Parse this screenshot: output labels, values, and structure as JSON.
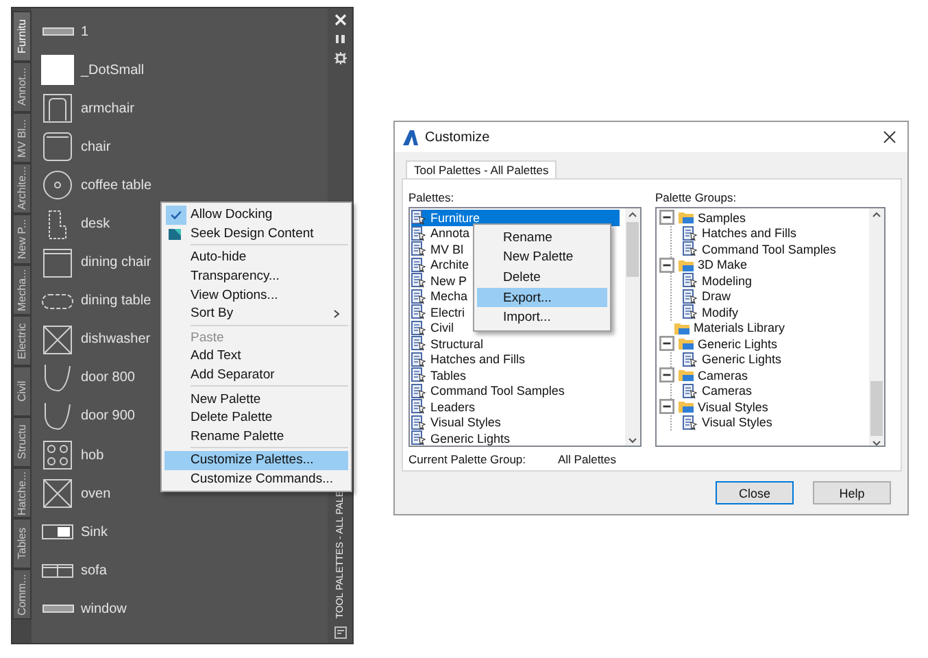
{
  "tool_palette": {
    "tabs": [
      {
        "label": "Furnitu",
        "selected": true
      },
      {
        "label": "Annot...",
        "selected": false
      },
      {
        "label": "MV Bl...",
        "selected": false
      },
      {
        "label": "Archite...",
        "selected": false
      },
      {
        "label": "New P...",
        "selected": false
      },
      {
        "label": "Mecha...",
        "selected": false
      },
      {
        "label": "Electric",
        "selected": false
      },
      {
        "label": "Civil",
        "selected": false
      },
      {
        "label": "Structu",
        "selected": false
      },
      {
        "label": "Hatche...",
        "selected": false
      },
      {
        "label": "Tables",
        "selected": false
      },
      {
        "label": "Comm...",
        "selected": false
      }
    ],
    "tools": [
      {
        "kind": "bar",
        "label": "1"
      },
      {
        "kind": "swatch",
        "label": "_DotSmall"
      },
      {
        "kind": "armchair",
        "label": "armchair"
      },
      {
        "kind": "chair",
        "label": "chair"
      },
      {
        "kind": "round",
        "label": "coffee table"
      },
      {
        "kind": "desk",
        "label": "desk"
      },
      {
        "kind": "square",
        "label": "dining chair"
      },
      {
        "kind": "oval",
        "label": "dining table"
      },
      {
        "kind": "crossed",
        "label": "dishwasher"
      },
      {
        "kind": "door",
        "label": "door 800"
      },
      {
        "kind": "door",
        "label": "door 900"
      },
      {
        "kind": "hob",
        "label": "hob"
      },
      {
        "kind": "crossed",
        "label": "oven"
      },
      {
        "kind": "sink",
        "label": "Sink"
      },
      {
        "kind": "sofa",
        "label": "sofa"
      },
      {
        "kind": "bar",
        "label": "window"
      }
    ],
    "title": "TOOL PALETTES - ALL PALE",
    "context_menu": [
      {
        "kind": "command",
        "label": "Allow Docking",
        "checked": true,
        "disabled": false,
        "selected": false
      },
      {
        "kind": "content",
        "label": "Seek Design Content",
        "checked": false,
        "disabled": false,
        "selected": false
      },
      {
        "kind": "separator"
      },
      {
        "kind": "command",
        "label": "Auto-hide",
        "checked": false,
        "disabled": false,
        "selected": false
      },
      {
        "kind": "command",
        "label": "Transparency...",
        "checked": false,
        "disabled": false,
        "selected": false
      },
      {
        "kind": "command",
        "label": "View Options...",
        "checked": false,
        "disabled": false,
        "selected": false
      },
      {
        "kind": "submenu",
        "label": "Sort By",
        "checked": false,
        "disabled": false,
        "selected": false
      },
      {
        "kind": "separator"
      },
      {
        "kind": "command",
        "label": "Paste",
        "checked": false,
        "disabled": true,
        "selected": false
      },
      {
        "kind": "command",
        "label": "Add Text",
        "checked": false,
        "disabled": false,
        "selected": false
      },
      {
        "kind": "command",
        "label": "Add Separator",
        "checked": false,
        "disabled": false,
        "selected": false
      },
      {
        "kind": "separator"
      },
      {
        "kind": "command",
        "label": "New Palette",
        "checked": false,
        "disabled": false,
        "selected": false
      },
      {
        "kind": "command",
        "label": "Delete Palette",
        "checked": false,
        "disabled": false,
        "selected": false
      },
      {
        "kind": "command",
        "label": "Rename Palette",
        "checked": false,
        "disabled": false,
        "selected": false
      },
      {
        "kind": "separator"
      },
      {
        "kind": "command",
        "label": "Customize Palettes...",
        "checked": false,
        "disabled": false,
        "selected": true
      },
      {
        "kind": "command",
        "label": "Customize Commands...",
        "checked": false,
        "disabled": false,
        "selected": false
      }
    ]
  },
  "customize_dialog": {
    "title": "Customize",
    "tabs": [
      {
        "label": "Tool Palettes - All Palettes",
        "selected": true
      }
    ],
    "palettes": {
      "label": "Palettes:",
      "items": [
        {
          "label": "Furniture",
          "selected": true
        },
        {
          "label": "Annota",
          "selected": false
        },
        {
          "label": "MV Bl",
          "selected": false
        },
        {
          "label": "Archite",
          "selected": false
        },
        {
          "label": "New P",
          "selected": false
        },
        {
          "label": "Mecha",
          "selected": false
        },
        {
          "label": "Electri",
          "selected": false
        },
        {
          "label": "Civil",
          "selected": false
        },
        {
          "label": "Structural",
          "selected": false
        },
        {
          "label": "Hatches and Fills",
          "selected": false
        },
        {
          "label": "Tables",
          "selected": false
        },
        {
          "label": "Command Tool Samples",
          "selected": false
        },
        {
          "label": "Leaders",
          "selected": false
        },
        {
          "label": "Visual Styles",
          "selected": false
        },
        {
          "label": "Generic Lights",
          "selected": false
        }
      ]
    },
    "palette_menu": [
      {
        "kind": "command",
        "label": "Rename",
        "selected": false
      },
      {
        "kind": "command",
        "label": "New Palette",
        "selected": false
      },
      {
        "kind": "command",
        "label": "Delete",
        "selected": false
      },
      {
        "kind": "command",
        "label": "Export...",
        "selected": true
      },
      {
        "kind": "command",
        "label": "Import...",
        "selected": false
      }
    ],
    "palette_groups": {
      "label": "Palette Groups:",
      "items": [
        {
          "label": "Samples",
          "expanded": true,
          "children": [
            {
              "label": "Hatches and Fills"
            },
            {
              "label": "Command Tool Samples"
            }
          ]
        },
        {
          "label": "3D Make",
          "expanded": true,
          "children": [
            {
              "label": "Modeling"
            },
            {
              "label": "Draw"
            },
            {
              "label": "Modify"
            }
          ]
        },
        {
          "label": "Materials Library"
        },
        {
          "label": "Generic Lights",
          "expanded": true,
          "children": [
            {
              "label": "Generic Lights"
            }
          ]
        },
        {
          "label": "Cameras",
          "expanded": true,
          "children": [
            {
              "label": "Cameras"
            }
          ]
        },
        {
          "label": "Visual Styles",
          "expanded": true,
          "children": [
            {
              "label": "Visual Styles"
            }
          ]
        }
      ]
    },
    "current_group": {
      "label": "Current Palette Group:",
      "value": "All Palettes"
    },
    "buttons": [
      {
        "label": "Close",
        "focused": true
      },
      {
        "label": "Help",
        "focused": false
      }
    ]
  }
}
